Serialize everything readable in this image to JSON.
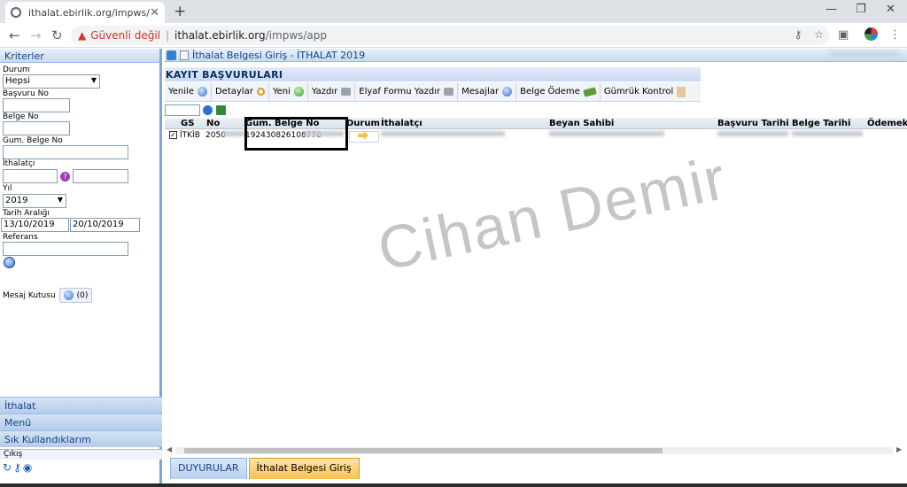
{
  "browser": {
    "tab_title": "ithalat.ebirlik.org/impws/app",
    "security_warning": "Güvenli değil",
    "url_host": "ithalat.ebirlik.org",
    "url_path": "/impws/app"
  },
  "left_panel": {
    "title": "Kriterler",
    "durum_label": "Durum",
    "durum_value": "Hepsi",
    "basvuru_no_label": "Başvuru No",
    "belge_no_label": "Belge No",
    "gum_belge_no_label": "Gum. Belge No",
    "ithalatci_label": "İthalatçı",
    "yil_label": "Yıl",
    "yil_value": "2019",
    "tarih_araligi_label": "Tarih Aralığı",
    "tarih_baslangic": "13/10/2019",
    "tarih_bitis": "20/10/2019",
    "referans_label": "Referans",
    "mesaj_kutusu_label": "Mesaj Kutusu",
    "mesaj_count": "(0)",
    "accordion": [
      "İthalat",
      "Menü",
      "Sık Kullandıklarım"
    ],
    "cikis_label": "Çıkış"
  },
  "right_panel": {
    "header_title": "İthalat Belgesi Giriş - İTHALAT 2019",
    "section_title": "KAYIT BAŞVURULARI",
    "toolbar": [
      "Yenile",
      "Detaylar",
      "Yeni",
      "Yazdır",
      "Elyaf Formu Yazdır",
      "Mesajlar",
      "Belge Ödeme",
      "Gümrük Kontrol"
    ],
    "columns": [
      "GS",
      "No",
      "Gum. Belge No",
      "Durum",
      "İthalatçı",
      "Beyan Sahibi",
      "Başvuru Tarihi",
      "Belge Tarihi",
      "Ödemek"
    ],
    "row": {
      "gs": "İTKİB",
      "no": "2050",
      "gum_belge_no": "192430826108776"
    },
    "bottom_tabs": [
      "DUYURULAR",
      "İthalat Belgesi Giriş"
    ]
  },
  "watermark": "Cihan Demir",
  "colors": {
    "panel_header": "#c9daf1",
    "active_tab": "#f7c24e",
    "warning": "#d93025"
  }
}
